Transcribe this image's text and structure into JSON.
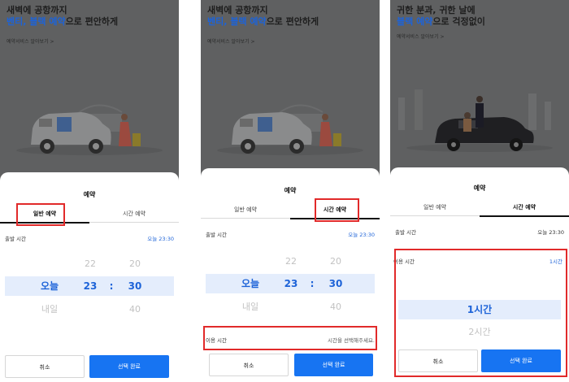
{
  "panel1": {
    "hero": {
      "line1": "새벽에 공항까지",
      "line2_blue": "벤티, 블랙 예약",
      "line2_rest": "으로 편안하게",
      "link": "예약서비스 알아보기  >"
    },
    "sheet": {
      "title": "예약",
      "tabs": [
        {
          "label": "일반 예약",
          "active": true
        },
        {
          "label": "시간 예약",
          "active": false
        }
      ],
      "departure_label": "출발 시간",
      "departure_value": "오늘 23:30",
      "picker": {
        "above": {
          "day": "",
          "hour": "22",
          "minute": "20"
        },
        "selected": {
          "day": "오늘",
          "hour": "23",
          "sep": ":",
          "minute": "30"
        },
        "below": {
          "day": "내일",
          "hour": "",
          "minute": "40"
        }
      },
      "cancel": "취소",
      "confirm": "선택 완료"
    }
  },
  "panel2": {
    "hero": {
      "line1": "새벽에 공항까지",
      "line2_blue": "벤티, 블랙 예약",
      "line2_rest": "으로 편안하게",
      "link": "예약서비스 알아보기  >"
    },
    "sheet": {
      "title": "예약",
      "tabs": [
        {
          "label": "일반 예약",
          "active": false
        },
        {
          "label": "시간 예약",
          "active": true
        }
      ],
      "departure_label": "출발 시간",
      "departure_value": "오늘 23:30",
      "picker": {
        "above": {
          "day": "",
          "hour": "22",
          "minute": "20"
        },
        "selected": {
          "day": "오늘",
          "hour": "23",
          "sep": ":",
          "minute": "30"
        },
        "below": {
          "day": "내일",
          "hour": "",
          "minute": "40"
        }
      },
      "usage_label": "이용 시간",
      "usage_placeholder": "시간을 선택해주세요.",
      "cancel": "취소",
      "confirm": "선택 완료"
    }
  },
  "panel3": {
    "hero": {
      "line1": "귀한 분과, 귀한 날에",
      "line2_blue": "블랙 예약",
      "line2_rest": "으로 걱정없이",
      "link": "예약서비스 알아보기  >"
    },
    "sheet": {
      "title": "예약",
      "tabs": [
        {
          "label": "일반 예약",
          "active": false
        },
        {
          "label": "시간 예약",
          "active": true
        }
      ],
      "departure_label": "출발 시간",
      "departure_value": "오늘 23:30",
      "usage_label": "이용 시간",
      "usage_value": "1시간",
      "duration_selected": "1시간",
      "duration_below": "2시간",
      "cancel": "취소",
      "confirm": "선택 완료"
    }
  }
}
